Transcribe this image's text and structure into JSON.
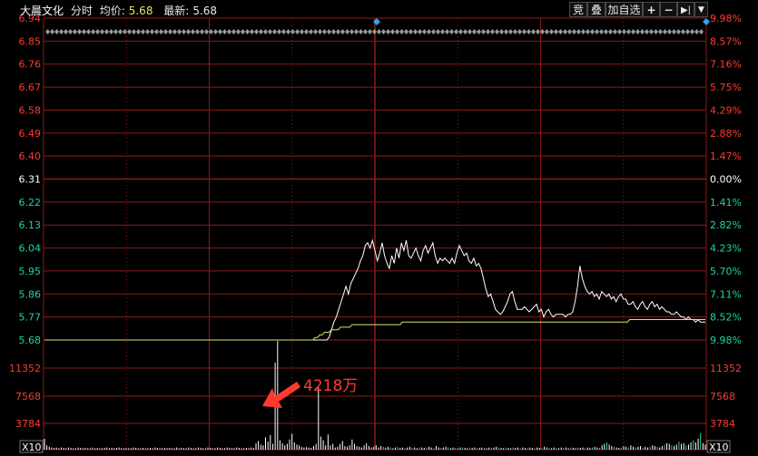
{
  "header": {
    "stock_name": "大晨文化",
    "mode": "分时",
    "avg_label": "均价:",
    "avg_value": "5.68",
    "last_label": "最新:",
    "last_value": "5.68"
  },
  "toolbar": {
    "bid_label": "竞",
    "overlay_label": "叠",
    "add_watch_label": "加自选",
    "zoom_in": "+",
    "zoom_out": "−",
    "jump_end": "▶|",
    "menu": "▼"
  },
  "price_axis": {
    "left": [
      "6.94",
      "6.85",
      "6.76",
      "6.67",
      "6.58",
      "6.49",
      "6.40",
      "6.31",
      "6.22",
      "6.13",
      "6.04",
      "5.95",
      "5.86",
      "5.77",
      "5.68"
    ],
    "right": [
      "9.98%",
      "8.57%",
      "7.16%",
      "5.75%",
      "4.29%",
      "2.88%",
      "1.47%",
      "0.00%",
      "1.41%",
      "2.82%",
      "4.23%",
      "5.70%",
      "7.11%",
      "8.52%",
      "9.98%"
    ],
    "prev_close": "6.31"
  },
  "volume_axis": {
    "left": [
      "11352",
      "7568",
      "3784"
    ],
    "right": [
      "11352",
      "7568",
      "3784"
    ],
    "scale_left": "X10",
    "scale_right": "X10"
  },
  "annotation": {
    "text": "4218万"
  },
  "colors": {
    "background": "#000000",
    "grid": "#8b1a1a",
    "up": "#ff3b30",
    "down": "#22d3a0",
    "price_line": "#ffffff",
    "avg_line": "#e6e06a",
    "volume_bar": "#ffffff",
    "marker": "#3aa0e8"
  },
  "chart_data": {
    "type": "line",
    "ylim": [
      5.68,
      6.94
    ],
    "series": [
      {
        "values": [
          5.68,
          5.68,
          5.68,
          5.68,
          5.68,
          5.68,
          5.68,
          5.68,
          5.68,
          5.68,
          5.68,
          5.68,
          5.68,
          5.68,
          5.68,
          5.68,
          5.68,
          5.68,
          5.68,
          5.68,
          5.68,
          5.68,
          5.68,
          5.68,
          5.68,
          5.68,
          5.68,
          5.68,
          5.68,
          5.68,
          5.68,
          5.68,
          5.68,
          5.68,
          5.68,
          5.68,
          5.68,
          5.68,
          5.68,
          5.68,
          5.68,
          5.68,
          5.68,
          5.68,
          5.68,
          5.68,
          5.68,
          5.68,
          5.68,
          5.68,
          5.68,
          5.68,
          5.68,
          5.68,
          5.68,
          5.68,
          5.68,
          5.68,
          5.68,
          5.68,
          5.68,
          5.68,
          5.68,
          5.68,
          5.68,
          5.68,
          5.68,
          5.68,
          5.68,
          5.68,
          5.68,
          5.68,
          5.68,
          5.68,
          5.68,
          5.68,
          5.68,
          5.68,
          5.68,
          5.68,
          5.68,
          5.68,
          5.68,
          5.68,
          5.68,
          5.68,
          5.68,
          5.68,
          5.68,
          5.68,
          5.68,
          5.68,
          5.68,
          5.68,
          5.68,
          5.68,
          5.68,
          5.68,
          5.68,
          5.68,
          5.68,
          5.68,
          5.68,
          5.68,
          5.68,
          5.68,
          5.68,
          5.68,
          5.68,
          5.68,
          5.68,
          5.68,
          5.68,
          5.68,
          5.68,
          5.68,
          5.68,
          5.68,
          5.69,
          5.72,
          5.75,
          5.77,
          5.8,
          5.83,
          5.86,
          5.89,
          5.86,
          5.9,
          5.92,
          5.94,
          5.96,
          5.99,
          6.01,
          6.05,
          6.06,
          6.04,
          6.07,
          6.03,
          5.99,
          6.02,
          6.06,
          6.01,
          5.98,
          5.96,
          6.01,
          5.98,
          6.04,
          6.0,
          6.06,
          6.03,
          6.07,
          6.01,
          6.0,
          6.02,
          6.04,
          6.01,
          5.99,
          6.03,
          6.05,
          6.02,
          6.04,
          6.06,
          6.01,
          5.98,
          6.0,
          5.99,
          6.0,
          5.99,
          5.98,
          6.0,
          5.98,
          6.02,
          6.05,
          6.03,
          6.01,
          6.02,
          5.99,
          5.98,
          6.0,
          5.97,
          5.98,
          5.96,
          5.92,
          5.88,
          5.85,
          5.86,
          5.83,
          5.8,
          5.79,
          5.78,
          5.79,
          5.81,
          5.83,
          5.86,
          5.87,
          5.83,
          5.8,
          5.8,
          5.8,
          5.81,
          5.8,
          5.79,
          5.8,
          5.81,
          5.82,
          5.79,
          5.8,
          5.77,
          5.79,
          5.8,
          5.78,
          5.77,
          5.78,
          5.78,
          5.78,
          5.78,
          5.77,
          5.78,
          5.78,
          5.79,
          5.83,
          5.89,
          5.97,
          5.92,
          5.89,
          5.87,
          5.86,
          5.87,
          5.85,
          5.86,
          5.84,
          5.87,
          5.86,
          5.85,
          5.86,
          5.84,
          5.85,
          5.83,
          5.85,
          5.86,
          5.84,
          5.84,
          5.82,
          5.82,
          5.83,
          5.81,
          5.8,
          5.82,
          5.83,
          5.81,
          5.8,
          5.82,
          5.83,
          5.81,
          5.82,
          5.8,
          5.81,
          5.8,
          5.79,
          5.79,
          5.78,
          5.78,
          5.79,
          5.78,
          5.77,
          5.77,
          5.76,
          5.77,
          5.76,
          5.76,
          5.75,
          5.76,
          5.75,
          5.75,
          5.75
        ]
      },
      {
        "values": [
          5.68,
          5.68,
          5.68,
          5.68,
          5.68,
          5.68,
          5.68,
          5.68,
          5.68,
          5.68,
          5.68,
          5.68,
          5.68,
          5.68,
          5.68,
          5.68,
          5.68,
          5.68,
          5.68,
          5.68,
          5.68,
          5.68,
          5.68,
          5.68,
          5.68,
          5.68,
          5.68,
          5.68,
          5.68,
          5.68,
          5.68,
          5.68,
          5.68,
          5.68,
          5.68,
          5.68,
          5.68,
          5.68,
          5.68,
          5.68,
          5.68,
          5.68,
          5.68,
          5.68,
          5.68,
          5.68,
          5.68,
          5.68,
          5.68,
          5.68,
          5.68,
          5.68,
          5.68,
          5.68,
          5.68,
          5.68,
          5.68,
          5.68,
          5.68,
          5.68,
          5.68,
          5.68,
          5.68,
          5.68,
          5.68,
          5.68,
          5.68,
          5.68,
          5.68,
          5.68,
          5.68,
          5.68,
          5.68,
          5.68,
          5.68,
          5.68,
          5.68,
          5.68,
          5.68,
          5.68,
          5.68,
          5.68,
          5.68,
          5.68,
          5.68,
          5.68,
          5.68,
          5.68,
          5.68,
          5.68,
          5.68,
          5.68,
          5.68,
          5.68,
          5.68,
          5.68,
          5.68,
          5.68,
          5.68,
          5.68,
          5.68,
          5.68,
          5.68,
          5.68,
          5.68,
          5.68,
          5.68,
          5.68,
          5.68,
          5.68,
          5.68,
          5.68,
          5.68,
          5.68,
          5.68,
          5.68,
          5.68,
          5.68,
          5.69,
          5.69,
          5.7,
          5.7,
          5.71,
          5.71,
          5.71,
          5.72,
          5.72,
          5.72,
          5.72,
          5.73,
          5.73,
          5.73,
          5.73,
          5.73,
          5.74,
          5.74,
          5.74,
          5.74,
          5.74,
          5.74,
          5.74,
          5.74,
          5.74,
          5.74,
          5.74,
          5.74,
          5.74,
          5.74,
          5.74,
          5.74,
          5.74,
          5.74,
          5.74,
          5.74,
          5.74,
          5.74,
          5.75,
          5.75,
          5.75,
          5.75,
          5.75,
          5.75,
          5.75,
          5.75,
          5.75,
          5.75,
          5.75,
          5.75,
          5.75,
          5.75,
          5.75,
          5.75,
          5.75,
          5.75,
          5.75,
          5.75,
          5.75,
          5.75,
          5.75,
          5.75,
          5.75,
          5.75,
          5.75,
          5.75,
          5.75,
          5.75,
          5.75,
          5.75,
          5.75,
          5.75,
          5.75,
          5.75,
          5.75,
          5.75,
          5.75,
          5.75,
          5.75,
          5.75,
          5.75,
          5.75,
          5.75,
          5.75,
          5.75,
          5.75,
          5.75,
          5.75,
          5.75,
          5.75,
          5.75,
          5.75,
          5.75,
          5.75,
          5.75,
          5.75,
          5.75,
          5.75,
          5.75,
          5.75,
          5.75,
          5.75,
          5.75,
          5.75,
          5.75,
          5.75,
          5.75,
          5.75,
          5.75,
          5.75,
          5.75,
          5.75,
          5.75,
          5.75,
          5.75,
          5.75,
          5.75,
          5.75,
          5.75,
          5.75,
          5.75,
          5.75,
          5.75,
          5.75,
          5.75,
          5.75,
          5.75,
          5.75,
          5.75,
          5.75,
          5.75,
          5.75,
          5.75,
          5.75,
          5.75,
          5.75,
          5.75,
          5.76,
          5.76,
          5.76,
          5.76,
          5.76,
          5.76,
          5.76,
          5.76,
          5.76,
          5.76,
          5.76,
          5.76,
          5.76,
          5.76,
          5.76,
          5.76,
          5.76,
          5.76,
          5.76,
          5.76,
          5.76,
          5.76,
          5.76,
          5.76,
          5.76,
          5.76,
          5.76,
          5.76,
          5.76,
          5.76,
          5.76,
          5.76,
          5.76,
          5.76
        ]
      }
    ],
    "volume": {
      "ylim": [
        0,
        15136
      ],
      "values": [
        1500,
        600,
        400,
        300,
        250,
        300,
        200,
        300,
        250,
        200,
        300,
        250,
        200,
        200,
        300,
        250,
        200,
        250,
        200,
        200,
        300,
        200,
        250,
        200,
        200,
        250,
        300,
        200,
        250,
        200,
        250,
        300,
        200,
        200,
        250,
        200,
        200,
        300,
        250,
        200,
        200,
        250,
        200,
        200,
        250,
        200,
        300,
        250,
        200,
        200,
        250,
        200,
        250,
        200,
        200,
        300,
        200,
        250,
        200,
        200,
        300,
        250,
        200,
        200,
        300,
        250,
        200,
        200,
        300,
        250,
        200,
        200,
        300,
        250,
        200,
        200,
        300,
        250,
        200,
        200,
        300,
        250,
        200,
        200,
        250,
        200,
        300,
        250,
        900,
        1200,
        700,
        600,
        1700,
        1100,
        2000,
        800,
        12000,
        15000,
        1300,
        900,
        600,
        800,
        1400,
        2200,
        1000,
        700,
        600,
        400,
        300,
        350,
        300,
        250,
        500,
        800,
        8600,
        1800,
        1300,
        600,
        2100,
        600,
        800,
        300,
        400,
        800,
        1200,
        500,
        400,
        600,
        1400,
        800,
        500,
        400,
        300,
        600,
        900,
        500,
        300,
        400,
        600,
        300,
        500,
        400,
        300,
        400,
        300,
        200,
        300,
        400,
        250,
        300,
        200,
        300,
        400,
        250,
        300,
        200,
        300,
        300,
        250,
        300,
        400,
        300,
        200,
        500,
        300,
        250,
        300,
        400,
        300,
        200,
        300,
        250,
        200,
        300,
        300,
        250,
        200,
        300,
        250,
        300,
        200,
        250,
        300,
        250,
        200,
        300,
        250,
        300,
        400,
        300,
        250,
        200,
        300,
        250,
        200,
        300,
        250,
        300,
        200,
        300,
        250,
        200,
        300,
        250,
        200,
        300,
        250,
        200,
        400,
        300,
        250,
        200,
        300,
        250,
        200,
        300,
        250,
        300,
        200,
        300,
        250,
        200,
        300,
        250,
        300,
        200,
        300,
        250,
        300,
        400,
        300,
        250,
        600,
        800,
        1000,
        700,
        500,
        400,
        300,
        250,
        300,
        500,
        400,
        300,
        600,
        400,
        300,
        400,
        500,
        300,
        400,
        300,
        400,
        600,
        500,
        400,
        300,
        500,
        700,
        900,
        800,
        600,
        500,
        700,
        1100,
        800,
        900,
        600,
        700,
        1000,
        1300,
        1000,
        1500,
        2300,
        900,
        700
      ]
    }
  }
}
